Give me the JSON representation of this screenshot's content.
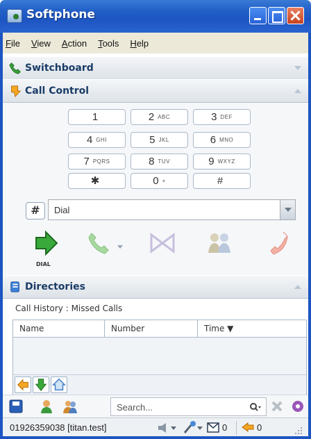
{
  "window": {
    "title": "Softphone"
  },
  "menu": [
    "File",
    "View",
    "Action",
    "Tools",
    "Help"
  ],
  "sections": {
    "switchboard": "Switchboard",
    "call_control": "Call Control",
    "directories": "Directories"
  },
  "keypad": [
    {
      "digit": "1",
      "letters": ""
    },
    {
      "digit": "2",
      "letters": "ABC"
    },
    {
      "digit": "3",
      "letters": "DEF"
    },
    {
      "digit": "4",
      "letters": "GHI"
    },
    {
      "digit": "5",
      "letters": "JKL"
    },
    {
      "digit": "6",
      "letters": "MNO"
    },
    {
      "digit": "7",
      "letters": "PQRS"
    },
    {
      "digit": "8",
      "letters": "TUV"
    },
    {
      "digit": "9",
      "letters": "WXYZ"
    },
    {
      "digit": "✱",
      "letters": ""
    },
    {
      "digit": "0",
      "letters": "+"
    },
    {
      "digit": "#",
      "letters": ""
    }
  ],
  "dial": {
    "hash_label": "#",
    "value": "Dial",
    "action_label": "DIAL"
  },
  "history": {
    "label": "Call History : Missed Calls",
    "columns": [
      "Name",
      "Number",
      "Time ▼"
    ]
  },
  "search": {
    "placeholder": "Search..."
  },
  "status": {
    "identity": "01926359038 [titan.test]",
    "voicemail_count": "0",
    "missed_count": "0"
  },
  "colors": {
    "titlebar": "#1d55c2",
    "accent_green": "#2e9b2e",
    "header_text": "#1b3c66"
  }
}
